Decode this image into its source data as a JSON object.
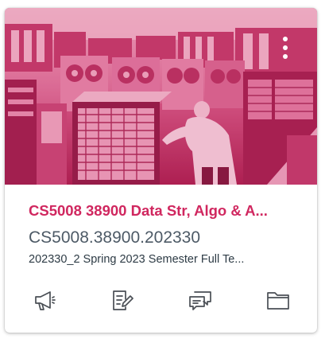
{
  "card": {
    "title": "CS5008 38900 Data Str, Algo & A...",
    "course_code": "CS5008.38900.202330",
    "term": "202330_2 Spring 2023 Semester Full Te...",
    "accent_color": "#d0275f",
    "overlay_color": "#c4245c"
  },
  "actions": [
    {
      "icon": "announcements-icon"
    },
    {
      "icon": "assignments-icon"
    },
    {
      "icon": "discussions-icon"
    },
    {
      "icon": "files-icon"
    }
  ],
  "menu": {
    "icon": "kebab-menu-icon"
  }
}
